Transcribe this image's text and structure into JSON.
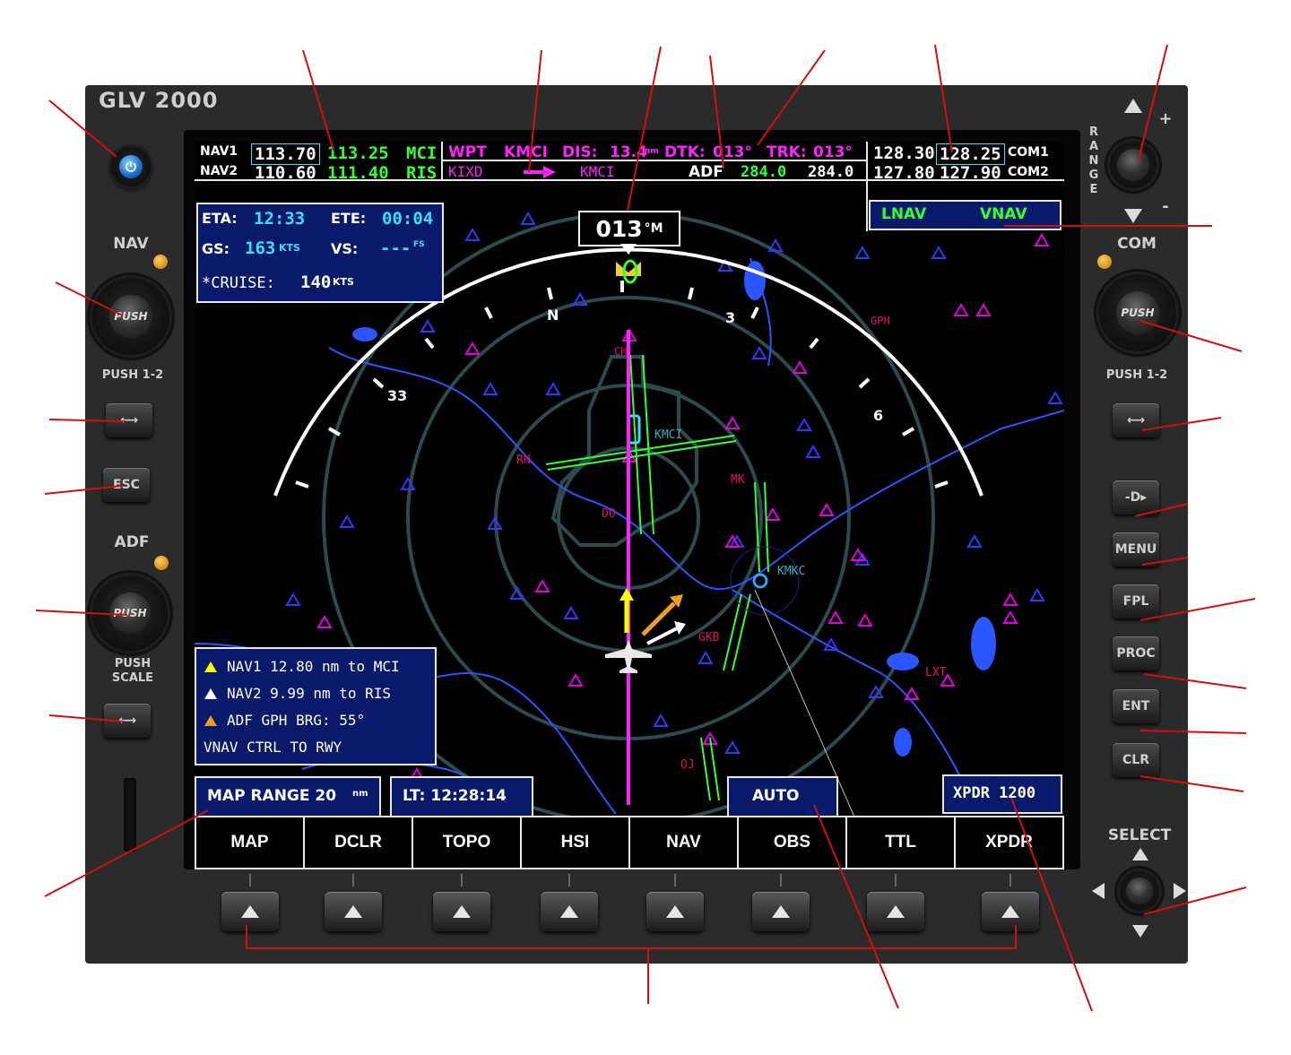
{
  "device": {
    "brand": "GLV 2000"
  },
  "left_controls": {
    "nav_label": "NAV",
    "push_label": "PUSH",
    "push12_label": "PUSH 1-2",
    "swap_glyph": "⟷",
    "esc_label": "ESC",
    "adf_label": "ADF",
    "push_scale_label_1": "PUSH",
    "push_scale_label_2": "SCALE"
  },
  "right_controls": {
    "range_label": "RANGE",
    "range_letters": [
      "R",
      "A",
      "N",
      "G",
      "E"
    ],
    "range_plus": "+",
    "range_minus": "-",
    "com_label": "COM",
    "push_label": "PUSH",
    "push12_label": "PUSH 1-2",
    "direct_to_glyph": "-D▸",
    "menu_label": "MENU",
    "fpl_label": "FPL",
    "proc_label": "PROC",
    "ent_label": "ENT",
    "clr_label": "CLR",
    "select_label": "SELECT"
  },
  "radios": {
    "nav1_label": "NAV1",
    "nav1_active": "113.70",
    "nav1_standby": "113.25",
    "nav1_ident": "MCI",
    "nav2_label": "NAV2",
    "nav2_active": "110.60",
    "nav2_standby": "111.40",
    "nav2_ident": "RIS",
    "com1_label": "COM1",
    "com1_active": "128.30",
    "com1_standby": "128.25",
    "com2_label": "COM2",
    "com2_active": "127.80",
    "com2_standby": "127.90"
  },
  "nav_status": {
    "wpt_label": "WPT",
    "wpt_value": "KMCI",
    "dis_label": "DIS:",
    "dis_value": "13.4",
    "dis_unit": "nm",
    "dtk_label": "DTK:",
    "dtk_value": "013°",
    "trk_label": "TRK:",
    "trk_value": "013°",
    "from_wpt": "KIXD",
    "to_wpt": "KMCI",
    "adf_label": "ADF",
    "adf_active": "284.0",
    "adf_standby": "284.0",
    "lnav": "LNAV",
    "vnav": "VNAV"
  },
  "flight_info": {
    "eta_label": "ETA:",
    "eta_value": "12:33",
    "ete_label": "ETE:",
    "ete_value": "00:04",
    "gs_label": "GS:",
    "gs_value": "163",
    "gs_unit": "KTS",
    "vs_label": "VS:",
    "vs_value": "---",
    "vs_unit": "FS",
    "cruise_label": "*CRUISE:",
    "cruise_value": "140",
    "cruise_unit": "KTS"
  },
  "heading": {
    "value": "013",
    "unit": "°M"
  },
  "compass_labels": {
    "n": "N",
    "e3": "3",
    "e6": "6",
    "w33": "33"
  },
  "map_labels": {
    "kmci": "KMCI",
    "kmkc": "KMKC",
    "rn": "RN",
    "do": "DO",
    "mk": "MK",
    "gkb": "GKB",
    "lxt": "LXT",
    "oj": "OJ",
    "gph": "GPH",
    "ch": "CH"
  },
  "bearing_info": {
    "line1": "NAV1  12.80 nm to MCI",
    "line2": "NAV2  9.99 nm to RIS",
    "line3": "ADF  GPH BRG: 55°",
    "line4": "VNAV CTRL TO RWY"
  },
  "bottom_status": {
    "map_range": "MAP RANGE 20",
    "map_range_unit": "nm",
    "local_time": "LT: 12:28:14",
    "auto": "AUTO",
    "xpdr": "XPDR 1200"
  },
  "softkeys": [
    "MAP",
    "DCLR",
    "TOPO",
    "HSI",
    "NAV",
    "OBS",
    "TTL",
    "XPDR"
  ],
  "colors": {
    "magenta": "#ff22ff",
    "green": "#33ff33",
    "cyan": "#33e0ff",
    "panel_blue": "#0a1a6a",
    "callout_red": "#d01010"
  }
}
